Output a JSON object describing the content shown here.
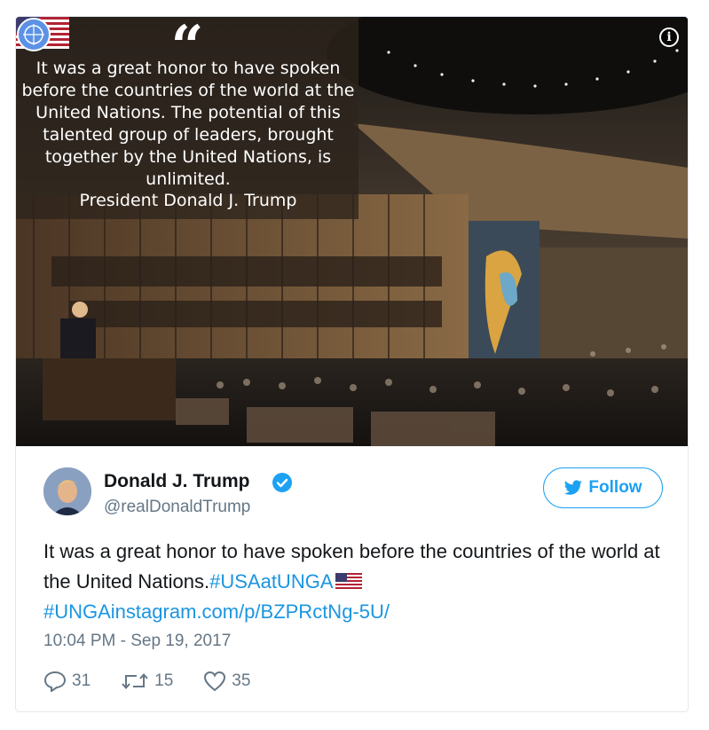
{
  "media": {
    "quote_mark": "“",
    "quote_text": "It was a great honor to have spoken before the countries of the world at the United Nations. The potential of this talented group of leaders, brought together by the United Nations, is unlimited.",
    "quote_author": "President Donald J. Trump",
    "info_icon": "info-icon",
    "info_label": "i"
  },
  "author": {
    "name": "Donald J. Trump",
    "handle": "@realDonaldTrump",
    "verified": true
  },
  "follow": {
    "label": "Follow",
    "icon": "twitter-bird-icon"
  },
  "tweet": {
    "text": "It was a great honor to have spoken before the countries of the world at the United Nations.",
    "hashtag1": "#USAatUNGA",
    "hashtag2": "#UNGA",
    "link": "instagram.com/p/BZPRctNg-5U/"
  },
  "timestamp": "10:04 PM - Sep 19, 2017",
  "actions": {
    "replies": "31",
    "retweets": "15",
    "likes": "35"
  },
  "colors": {
    "accent": "#1da1f2",
    "link": "#1b95e0",
    "muted": "#657786",
    "border": "#e1e8ed"
  }
}
